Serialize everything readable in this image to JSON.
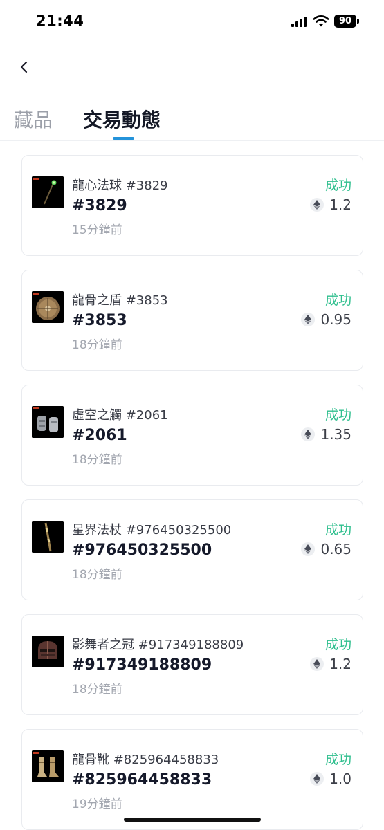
{
  "status_bar": {
    "time": "21:44",
    "battery": "90"
  },
  "tabs": [
    {
      "label": "藏品",
      "active": false
    },
    {
      "label": "交易動態",
      "active": true
    }
  ],
  "trades": [
    {
      "name": "龍心法球 #3829",
      "id": "#3829",
      "time": "15分鐘前",
      "status": "成功",
      "price": "1.2",
      "icon": "orb-staff-icon"
    },
    {
      "name": "龍骨之盾 #3853",
      "id": "#3853",
      "time": "18分鐘前",
      "status": "成功",
      "price": "0.95",
      "icon": "shield-icon"
    },
    {
      "name": "虛空之觸 #2061",
      "id": "#2061",
      "time": "18分鐘前",
      "status": "成功",
      "price": "1.35",
      "icon": "gauntlets-icon"
    },
    {
      "name": "星界法杖 #976450325500",
      "id": "#976450325500",
      "time": "18分鐘前",
      "status": "成功",
      "price": "0.65",
      "icon": "staff-icon"
    },
    {
      "name": "影舞者之冠 #917349188809",
      "id": "#917349188809",
      "time": "18分鐘前",
      "status": "成功",
      "price": "1.2",
      "icon": "helm-icon"
    },
    {
      "name": "龍骨靴 #825964458833",
      "id": "#825964458833",
      "time": "19分鐘前",
      "status": "成功",
      "price": "1.0",
      "icon": "boots-icon"
    }
  ],
  "colors": {
    "accent": "#2493da",
    "success": "#2fbf8e",
    "thumb_bg": "#000000"
  }
}
